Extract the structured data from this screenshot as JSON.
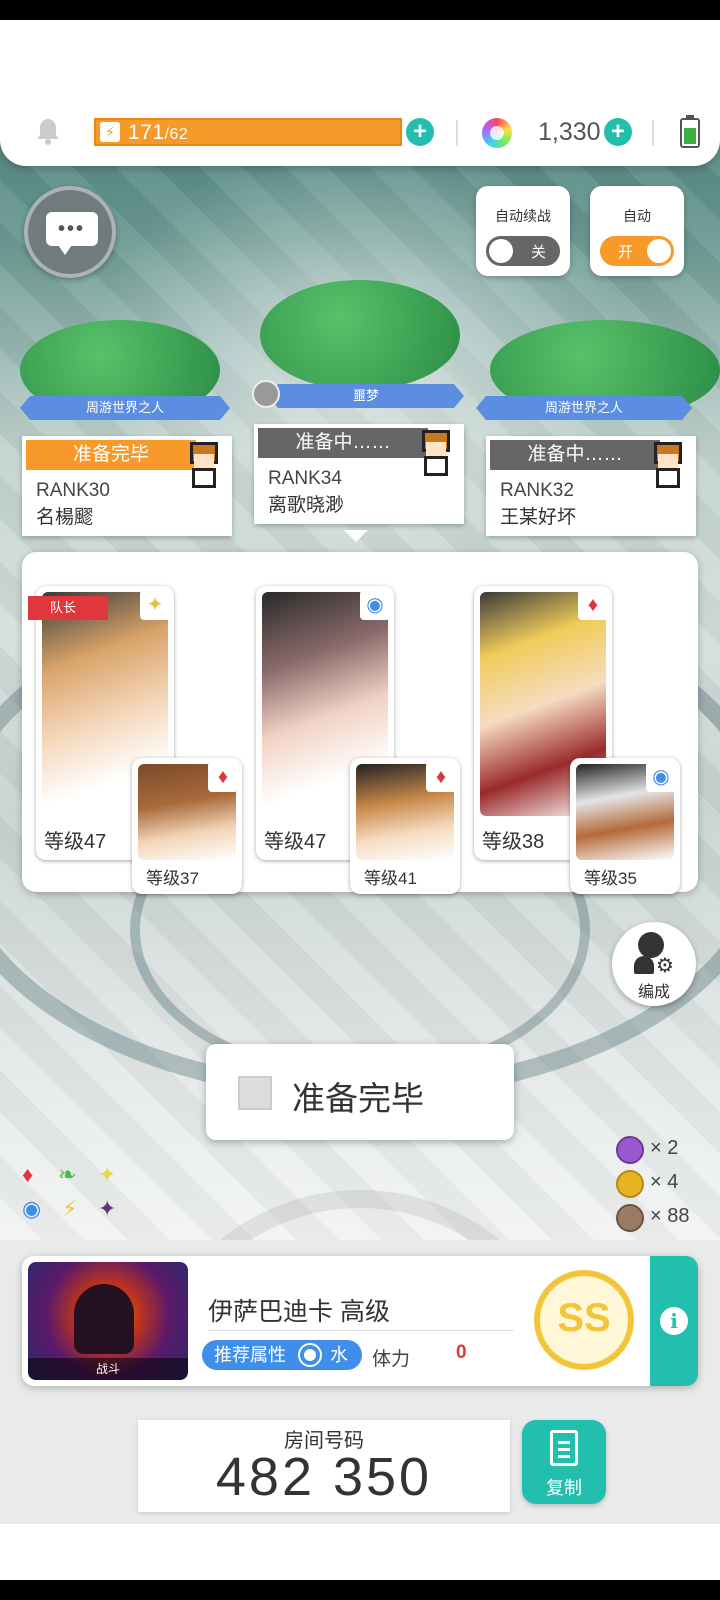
{
  "topbar": {
    "energy_value": "171",
    "energy_max": "/62",
    "energy_fill_fraction": 1.0,
    "gems": "1,330"
  },
  "toggles": {
    "auto_continue": {
      "label": "自动续战",
      "state": "关"
    },
    "auto": {
      "label": "自动",
      "state": "开"
    }
  },
  "players": [
    {
      "title": "周游世界之人",
      "status": "准备完毕",
      "rank": "RANK30",
      "name": "名楊飂"
    },
    {
      "title": "噩梦",
      "status": "准备中……",
      "rank": "RANK34",
      "name": "离歌晓渺"
    },
    {
      "title": "周游世界之人",
      "status": "准备中……",
      "rank": "RANK32",
      "name": "王某好坏"
    }
  ],
  "team": {
    "captain_label": "队长",
    "slots": [
      {
        "main_level": "等级47",
        "sub_level": "等级37"
      },
      {
        "main_level": "等级47",
        "sub_level": "等级41"
      },
      {
        "main_level": "等级38",
        "sub_level": "等级35"
      }
    ]
  },
  "edit_label": "编成",
  "ready_button": "准备完毕",
  "items": [
    {
      "color": "#9b59d0",
      "count": "× 2"
    },
    {
      "color": "#e6b422",
      "count": "× 4"
    },
    {
      "color": "#9a7b63",
      "count": "× 88"
    }
  ],
  "quest": {
    "boss_label": "战斗",
    "name": "伊萨巴迪卡 高级",
    "recommended_label": "推荐属性",
    "element": "水",
    "stamina_label": "体力",
    "stamina_value": "0",
    "rank": "SS"
  },
  "room": {
    "label": "房间号码",
    "number": "482 350",
    "copy_label": "复制"
  },
  "colors": {
    "accent": "#23bfae",
    "orange": "#f89a2a",
    "blue": "#3f8ee8",
    "red": "#e0373c"
  }
}
